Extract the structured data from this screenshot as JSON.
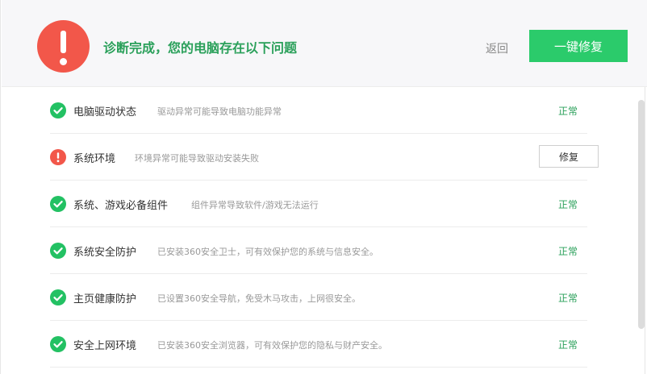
{
  "header": {
    "title": "诊断完成，您的电脑存在以下问题",
    "back_label": "返回",
    "fix_all_label": "一键修复"
  },
  "colors": {
    "accent_green": "#2bcb6b",
    "text_green": "#2aa05a",
    "alert_red": "#f2574a"
  },
  "items": [
    {
      "name": "电脑驱动状态",
      "desc": "驱动异常可能导致电脑功能异常",
      "status": "ok",
      "state_label": "正常"
    },
    {
      "name": "系统环境",
      "desc": "环境异常可能导致驱动安装失败",
      "status": "error",
      "action_label": "修复"
    },
    {
      "name": "系统、游戏必备组件",
      "desc": "组件异常导致软件/游戏无法运行",
      "status": "ok",
      "state_label": "正常"
    },
    {
      "name": "系统安全防护",
      "desc": "已安装360安全卫士，可有效保护您的系统与信息安全。",
      "status": "ok",
      "state_label": "正常"
    },
    {
      "name": "主页健康防护",
      "desc": "已设置360安全导航，免受木马攻击，上网很安全。",
      "status": "ok",
      "state_label": "正常"
    },
    {
      "name": "安全上网环境",
      "desc": "已安装360安全浏览器，可有效保护您的隐私与财产安全。",
      "status": "ok",
      "state_label": "正常"
    }
  ],
  "icons": {
    "header": "alert-exclamation-icon",
    "ok": "check-circle-icon",
    "error": "exclamation-circle-icon"
  }
}
